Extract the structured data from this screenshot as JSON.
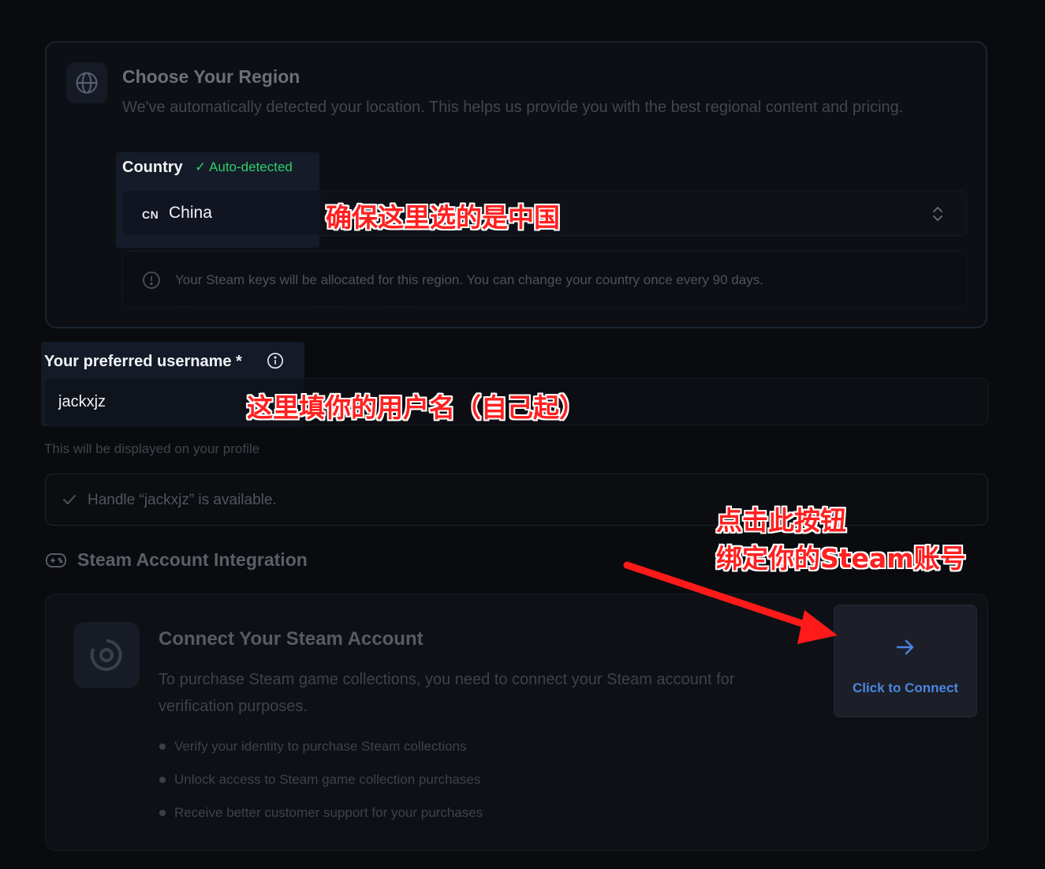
{
  "region": {
    "title": "Choose Your Region",
    "description": "We've automatically detected your location. This helps us provide you with the best regional content and pricing.",
    "country_label": "Country",
    "auto_detected": "✓ Auto-detected",
    "country_code": "CN",
    "country_name": "China",
    "notice": "Your Steam keys will be allocated for this region. You can change your country once every 90 days."
  },
  "username": {
    "label": "Your preferred username *",
    "value": "jackxjz",
    "help": "This will be displayed on your profile",
    "availability": "Handle “jackxjz” is available."
  },
  "steam": {
    "section_title": "Steam Account Integration",
    "card_title": "Connect Your Steam Account",
    "card_description": "To purchase Steam game collections, you need to connect your Steam account for verification purposes.",
    "benefits": [
      "Verify your identity to purchase Steam collections",
      "Unlock access to Steam game collection purchases",
      "Receive better customer support for your purchases"
    ],
    "connect_label": "Click to Connect"
  },
  "annotations": {
    "country_note": "确保这里选的是中国",
    "username_note": "这里填你的用户名（自己起）",
    "connect_note_line1": "点击此按钮",
    "connect_note_line2": "绑定你的Steam账号"
  },
  "colors": {
    "background": "#0a0b0e",
    "accent_green": "#2ecf6a",
    "link_blue": "#4a86e0",
    "annotation_red": "#ff2020"
  },
  "icons": [
    "globe-icon",
    "up-down-chevron-icon",
    "info-circle-icon",
    "info-icon",
    "check-icon",
    "gamepad-icon",
    "steam-logo-icon",
    "arrow-right-icon"
  ]
}
